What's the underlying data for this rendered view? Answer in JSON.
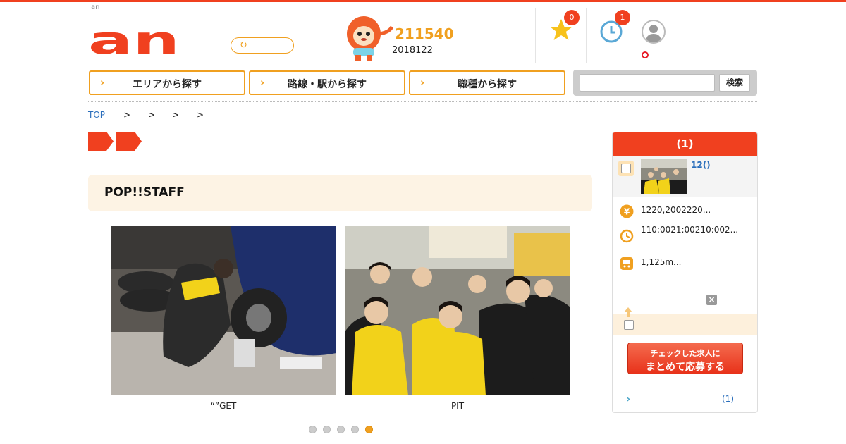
{
  "header": {
    "brand_small": "an",
    "logo_text": "an",
    "mascot_count": "211540",
    "mascot_sub": "2018122",
    "favorites_badge": "0",
    "history_badge": "1"
  },
  "nav": {
    "area": "エリアから探す",
    "station": "路線・駅から探す",
    "job_type": "職種から探す"
  },
  "search": {
    "placeholder": "",
    "button": "検索"
  },
  "breadcrumb": {
    "top": "TOP",
    "sep": ">"
  },
  "main": {
    "title": "POP!!STAFF",
    "photos": [
      {
        "caption": "“”GET"
      },
      {
        "caption": "PIT"
      }
    ],
    "slide_count": 5,
    "active_slide": 5
  },
  "sidebar": {
    "header": "(1)",
    "item_link": "12()",
    "salary": "1220,2002220...",
    "hours": "110:0021:00210:002...",
    "access": "1,125m...",
    "close": "×",
    "apply_line1": "チェックした求人に",
    "apply_line2": "まとめて応募する",
    "footer_count": "(1)"
  },
  "colors": {
    "brand_red": "#f0401f",
    "accent_orange": "#f0a020",
    "link_blue": "#2a6ebb",
    "title_bg": "#fdf3e4"
  }
}
